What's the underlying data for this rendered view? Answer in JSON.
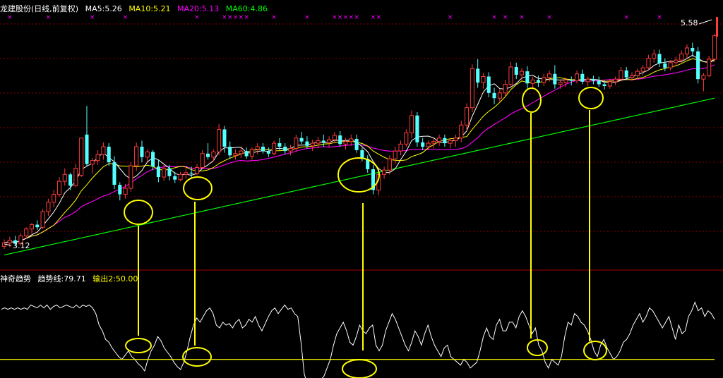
{
  "main_header": {
    "title": "龙建股份(日线,前复权)",
    "items": [
      {
        "label": "MA5:5.26",
        "color": "#ffffff"
      },
      {
        "label": "MA10:5.21",
        "color": "#ffff00"
      },
      {
        "label": "MA20:5.13",
        "color": "#ff00ff"
      },
      {
        "label": "MA60:4.86",
        "color": "#00ff00"
      }
    ]
  },
  "sub_header": {
    "items": [
      {
        "label": "神奇趋势",
        "color": "#ffffff"
      },
      {
        "label": "趋势线:79.71",
        "color": "#ffffff"
      },
      {
        "label": "输出2:50.00",
        "color": "#ffff00"
      }
    ]
  },
  "colors": {
    "up": "#ff3b3b",
    "down": "#54ffff",
    "ma5": "#ffffff",
    "ma10": "#ffff00",
    "ma20": "#ff00ff",
    "ma60": "#00ff00",
    "indicator": "#ffffff",
    "output2": "#ffff00",
    "grid": "#8b0000",
    "annotation": "#ffff00",
    "marker": "#ff00ff"
  },
  "chart_data": [
    {
      "type": "candlestick",
      "ylim": [
        2.9,
        5.7
      ],
      "labels": {
        "high": "5.58",
        "low": "3.12"
      },
      "markers": {
        "symbol": "×",
        "x_indices": [
          1,
          8,
          16,
          22,
          35,
          40,
          41,
          42,
          43,
          44,
          49,
          55,
          60,
          61,
          62,
          63,
          64,
          67,
          68,
          81,
          89,
          91,
          94,
          99,
          113,
          119
        ]
      },
      "ohlc": [
        [
          3.15,
          3.23,
          3.12,
          3.19
        ],
        [
          3.19,
          3.26,
          3.14,
          3.22
        ],
        [
          3.22,
          3.27,
          3.15,
          3.18
        ],
        [
          3.18,
          3.3,
          3.16,
          3.27
        ],
        [
          3.27,
          3.37,
          3.24,
          3.35
        ],
        [
          3.35,
          3.42,
          3.3,
          3.4
        ],
        [
          3.4,
          3.45,
          3.34,
          3.37
        ],
        [
          3.37,
          3.58,
          3.35,
          3.55
        ],
        [
          3.55,
          3.7,
          3.5,
          3.66
        ],
        [
          3.66,
          3.8,
          3.6,
          3.75
        ],
        [
          3.75,
          3.95,
          3.72,
          3.9
        ],
        [
          3.9,
          4.05,
          3.85,
          3.98
        ],
        [
          3.98,
          4.0,
          3.8,
          3.85
        ],
        [
          3.85,
          4.1,
          3.83,
          4.05
        ],
        [
          3.97,
          4.3,
          3.95,
          4.4
        ],
        [
          4.44,
          4.77,
          4.07,
          4.1
        ],
        [
          4.1,
          4.17,
          3.99,
          4.14
        ],
        [
          4.14,
          4.26,
          4.09,
          4.21
        ],
        [
          4.21,
          4.35,
          4.15,
          4.3
        ],
        [
          4.3,
          4.34,
          4.08,
          4.12
        ],
        [
          4.12,
          4.19,
          3.81,
          3.86
        ],
        [
          3.86,
          3.89,
          3.68,
          3.75
        ],
        [
          3.75,
          3.87,
          3.7,
          3.82
        ],
        [
          3.82,
          4.12,
          3.78,
          4.08
        ],
        [
          4.08,
          4.35,
          4.02,
          4.3
        ],
        [
          4.3,
          4.37,
          4.12,
          4.18
        ],
        [
          4.18,
          4.27,
          4.13,
          4.24
        ],
        [
          4.24,
          4.26,
          4.03,
          4.07
        ],
        [
          4.07,
          4.15,
          3.89,
          3.95
        ],
        [
          3.95,
          4.09,
          3.91,
          4.05
        ],
        [
          4.05,
          4.09,
          3.91,
          3.96
        ],
        [
          3.96,
          4.01,
          3.88,
          3.92
        ],
        [
          3.92,
          4.01,
          3.9,
          3.98
        ],
        [
          3.98,
          4.05,
          3.93,
          4.0
        ],
        [
          4.0,
          4.07,
          3.93,
          3.99
        ],
        [
          3.99,
          4.1,
          3.97,
          4.06
        ],
        [
          4.06,
          4.26,
          4.04,
          4.22
        ],
        [
          4.22,
          4.34,
          4.15,
          4.18
        ],
        [
          4.18,
          4.27,
          4.13,
          4.24
        ],
        [
          4.24,
          4.56,
          4.2,
          4.5
        ],
        [
          4.5,
          4.54,
          4.23,
          4.3
        ],
        [
          4.3,
          4.36,
          4.16,
          4.2
        ],
        [
          4.2,
          4.27,
          4.15,
          4.22
        ],
        [
          4.22,
          4.29,
          4.17,
          4.25
        ],
        [
          4.25,
          4.29,
          4.16,
          4.19
        ],
        [
          4.19,
          4.29,
          4.15,
          4.27
        ],
        [
          4.27,
          4.34,
          4.21,
          4.3
        ],
        [
          4.3,
          4.34,
          4.22,
          4.25
        ],
        [
          4.25,
          4.29,
          4.18,
          4.22
        ],
        [
          4.22,
          4.37,
          4.2,
          4.34
        ],
        [
          4.34,
          4.4,
          4.26,
          4.3
        ],
        [
          4.3,
          4.34,
          4.21,
          4.25
        ],
        [
          4.25,
          4.32,
          4.2,
          4.28
        ],
        [
          4.28,
          4.44,
          4.24,
          4.4
        ],
        [
          4.4,
          4.47,
          4.33,
          4.36
        ],
        [
          4.36,
          4.42,
          4.28,
          4.31
        ],
        [
          4.31,
          4.38,
          4.25,
          4.34
        ],
        [
          4.34,
          4.41,
          4.28,
          4.37
        ],
        [
          4.37,
          4.44,
          4.3,
          4.35
        ],
        [
          4.35,
          4.42,
          4.3,
          4.38
        ],
        [
          4.38,
          4.47,
          4.34,
          4.43
        ],
        [
          4.43,
          4.48,
          4.3,
          4.33
        ],
        [
          4.33,
          4.4,
          4.27,
          4.36
        ],
        [
          4.36,
          4.44,
          4.31,
          4.39
        ],
        [
          4.39,
          4.44,
          4.23,
          4.26
        ],
        [
          4.26,
          4.29,
          4.13,
          4.16
        ],
        [
          4.16,
          4.2,
          4.0,
          4.04
        ],
        [
          4.04,
          4.09,
          3.75,
          3.8
        ],
        [
          3.8,
          4.0,
          3.74,
          3.98
        ],
        [
          3.98,
          4.07,
          3.93,
          4.03
        ],
        [
          4.03,
          4.2,
          3.98,
          4.16
        ],
        [
          4.16,
          4.3,
          4.1,
          4.25
        ],
        [
          4.25,
          4.37,
          4.2,
          4.33
        ],
        [
          4.33,
          4.5,
          4.3,
          4.46
        ],
        [
          4.46,
          4.72,
          4.4,
          4.66
        ],
        [
          4.66,
          4.7,
          4.3,
          4.35
        ],
        [
          4.35,
          4.4,
          4.26,
          4.3
        ],
        [
          4.3,
          4.37,
          4.26,
          4.34
        ],
        [
          4.34,
          4.4,
          4.28,
          4.36
        ],
        [
          4.36,
          4.44,
          4.31,
          4.4
        ],
        [
          4.4,
          4.44,
          4.3,
          4.34
        ],
        [
          4.34,
          4.4,
          4.28,
          4.37
        ],
        [
          4.37,
          4.44,
          4.3,
          4.4
        ],
        [
          4.4,
          4.6,
          4.35,
          4.55
        ],
        [
          4.55,
          4.8,
          4.48,
          4.75
        ],
        [
          4.75,
          5.25,
          4.7,
          5.2
        ],
        [
          5.2,
          5.31,
          4.98,
          5.04
        ],
        [
          5.04,
          5.15,
          4.97,
          5.11
        ],
        [
          5.11,
          5.16,
          4.87,
          4.92
        ],
        [
          4.92,
          4.98,
          4.79,
          4.86
        ],
        [
          4.86,
          4.96,
          4.81,
          4.92
        ],
        [
          4.92,
          5.07,
          4.88,
          5.02
        ],
        [
          5.02,
          5.28,
          4.98,
          5.22
        ],
        [
          5.22,
          5.27,
          5.08,
          5.13
        ],
        [
          5.13,
          5.21,
          5.07,
          5.17
        ],
        [
          5.17,
          5.23,
          4.97,
          5.03
        ],
        [
          5.03,
          5.11,
          4.97,
          5.07
        ],
        [
          5.07,
          5.12,
          4.99,
          5.04
        ],
        [
          5.04,
          5.14,
          5.0,
          5.1
        ],
        [
          5.1,
          5.18,
          5.05,
          5.14
        ],
        [
          5.14,
          5.24,
          4.97,
          5.02
        ],
        [
          5.02,
          5.08,
          4.97,
          5.04
        ],
        [
          5.04,
          5.1,
          4.99,
          5.07
        ],
        [
          5.07,
          5.11,
          5.01,
          5.06
        ],
        [
          5.06,
          5.18,
          5.03,
          5.14
        ],
        [
          5.14,
          5.19,
          5.02,
          5.05
        ],
        [
          5.05,
          5.11,
          5.0,
          5.08
        ],
        [
          5.08,
          5.12,
          5.02,
          5.06
        ],
        [
          5.06,
          5.11,
          4.99,
          5.02
        ],
        [
          5.02,
          5.07,
          4.96,
          5.0
        ],
        [
          5.0,
          5.08,
          4.97,
          5.05
        ],
        [
          5.05,
          5.11,
          5.01,
          5.08
        ],
        [
          5.08,
          5.22,
          5.05,
          5.18
        ],
        [
          5.18,
          5.22,
          5.07,
          5.1
        ],
        [
          5.1,
          5.16,
          5.06,
          5.12
        ],
        [
          5.12,
          5.2,
          5.08,
          5.17
        ],
        [
          5.17,
          5.24,
          5.12,
          5.21
        ],
        [
          5.21,
          5.36,
          5.18,
          5.32
        ],
        [
          5.32,
          5.42,
          5.27,
          5.37
        ],
        [
          5.37,
          5.42,
          5.22,
          5.26
        ],
        [
          5.26,
          5.32,
          5.17,
          5.21
        ],
        [
          5.21,
          5.3,
          5.18,
          5.27
        ],
        [
          5.27,
          5.34,
          5.24,
          5.3
        ],
        [
          5.3,
          5.41,
          5.27,
          5.37
        ],
        [
          5.37,
          5.48,
          5.32,
          5.44
        ],
        [
          5.44,
          5.5,
          5.34,
          5.4
        ],
        [
          5.4,
          5.45,
          5.03,
          5.08
        ],
        [
          5.08,
          5.15,
          4.94,
          5.12
        ],
        [
          5.12,
          5.35,
          5.1,
          5.31
        ],
        [
          5.31,
          5.6,
          5.28,
          5.58
        ]
      ]
    },
    {
      "type": "line",
      "title": "神奇趋势",
      "ylim": [
        40,
        105
      ],
      "series": [
        {
          "name": "趋势线",
          "values": [
            85,
            86,
            85,
            86,
            85,
            86,
            85,
            86,
            85,
            88,
            87,
            86,
            88,
            86,
            88,
            85,
            87,
            88,
            86,
            87,
            88,
            87,
            86,
            88,
            86,
            88,
            87,
            88,
            86,
            82,
            74,
            70,
            64,
            62,
            58,
            55,
            52,
            50,
            53,
            56,
            52,
            50,
            47,
            45,
            42,
            50,
            56,
            60,
            66,
            63,
            58,
            55,
            52,
            48,
            45,
            43,
            48,
            56,
            66,
            74,
            79,
            76,
            80,
            84,
            86,
            82,
            74,
            72,
            76,
            74,
            75,
            72,
            76,
            78,
            72,
            74,
            78,
            76,
            80,
            74,
            70,
            75,
            80,
            84,
            86,
            82,
            85,
            88,
            85,
            86,
            82,
            80,
            62,
            40,
            32,
            28,
            30,
            33,
            36,
            38,
            44,
            50,
            60,
            68,
            72,
            76,
            70,
            62,
            60,
            66,
            74,
            70,
            68,
            72,
            74,
            60,
            56,
            60,
            70,
            76,
            82,
            78,
            72,
            66,
            60,
            56,
            62,
            70,
            66,
            60,
            68,
            74,
            66,
            60,
            56,
            52,
            58,
            60,
            52,
            50,
            48,
            46,
            50,
            48,
            44,
            46,
            48,
            56,
            66,
            72,
            66,
            64,
            74,
            78,
            70,
            70,
            76,
            76,
            72,
            80,
            84,
            80,
            74,
            68,
            72,
            60,
            56,
            48,
            44,
            50,
            48,
            46,
            52,
            66,
            76,
            74,
            82,
            80,
            76,
            74,
            70,
            64,
            56,
            52,
            60,
            64,
            58,
            54,
            50,
            52,
            56,
            62,
            64,
            68,
            74,
            78,
            82,
            76,
            80,
            86,
            84,
            80,
            76,
            72,
            76,
            80,
            72,
            64,
            74,
            68,
            70,
            80,
            84,
            90,
            84,
            86,
            80,
            84,
            82,
            78
          ]
        },
        {
          "name": "输出2",
          "values": [
            50
          ]
        }
      ]
    }
  ]
}
